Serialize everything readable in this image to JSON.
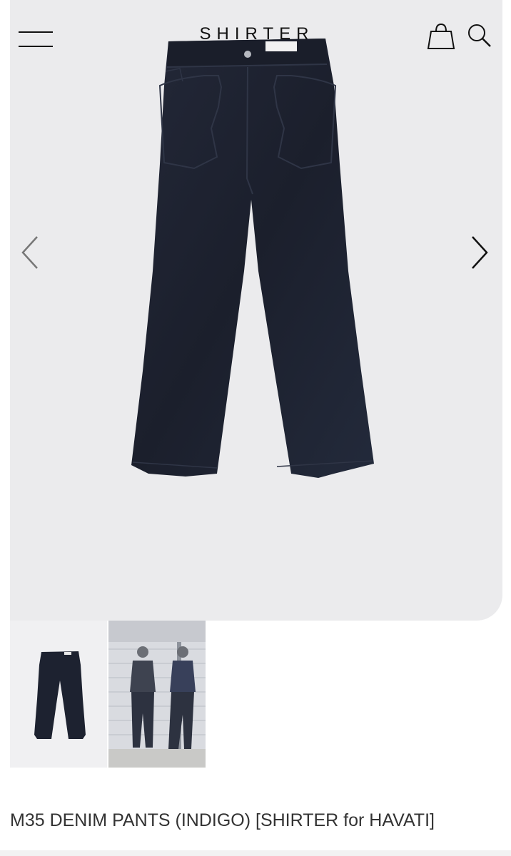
{
  "header": {
    "brand": "SHIRTER",
    "menu_icon": "hamburger-menu-icon",
    "cart_icon": "shopping-bag-icon",
    "search_icon": "search-icon"
  },
  "gallery": {
    "prev_icon": "chevron-left-icon",
    "next_icon": "chevron-right-icon",
    "main_image": "indigo denim wide-leg pants",
    "thumbnails": [
      "indigo denim pants flat lay",
      "two men wearing the pants outdoors"
    ],
    "colors": {
      "background": "#ebebed",
      "denim": "#1d2230"
    }
  },
  "product": {
    "title": "M35 DENIM PANTS (INDIGO) [SHIRTER for HAVATI]"
  }
}
